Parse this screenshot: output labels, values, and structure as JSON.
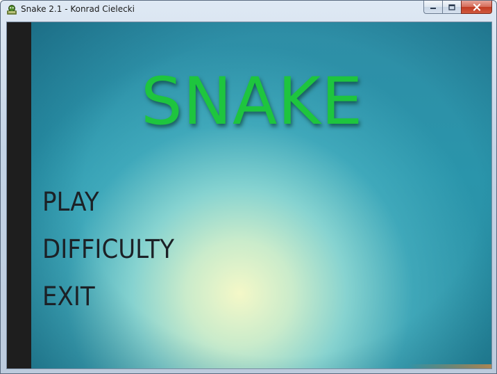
{
  "window": {
    "title": "Snake 2.1 - Konrad Cielecki",
    "app_icon": "snake-app-icon",
    "caption_buttons": {
      "minimize_icon": "minimize-icon",
      "maximize_icon": "maximize-icon",
      "close_icon": "close-icon"
    }
  },
  "game": {
    "logo": "SNAKE",
    "logo_color": "#1ec53e",
    "menu": [
      {
        "label": "PLAY"
      },
      {
        "label": "DIFFICULTY"
      },
      {
        "label": "EXIT"
      }
    ]
  }
}
